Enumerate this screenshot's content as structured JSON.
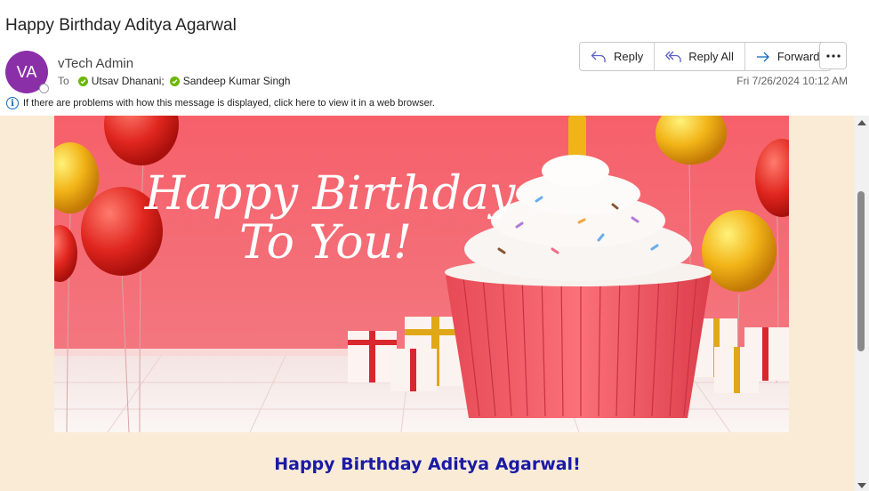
{
  "email": {
    "subject": "Happy Birthday Aditya Agarwal",
    "sender": {
      "name": "vTech Admin",
      "initials": "VA",
      "avatar_color": "#8b2fa8"
    },
    "to_label": "To",
    "recipients": [
      "Utsav Dhanani;",
      "Sandeep Kumar Singh"
    ],
    "date": "Fri 7/26/2024 10:12 AM",
    "info_message": "If there are problems with how this message is displayed, click here to view it in a web browser."
  },
  "toolbar": {
    "reply_label": "Reply",
    "reply_all_label": "Reply All",
    "forward_label": "Forward",
    "more_icon": "more-horizontal-icon"
  },
  "body": {
    "background": "#faebd7",
    "banner": {
      "line1": "Happy Birthday",
      "line2": "To You!"
    },
    "greeting": "Happy Birthday Aditya Agarwal!",
    "greeting_color": "#1a1aa6"
  }
}
